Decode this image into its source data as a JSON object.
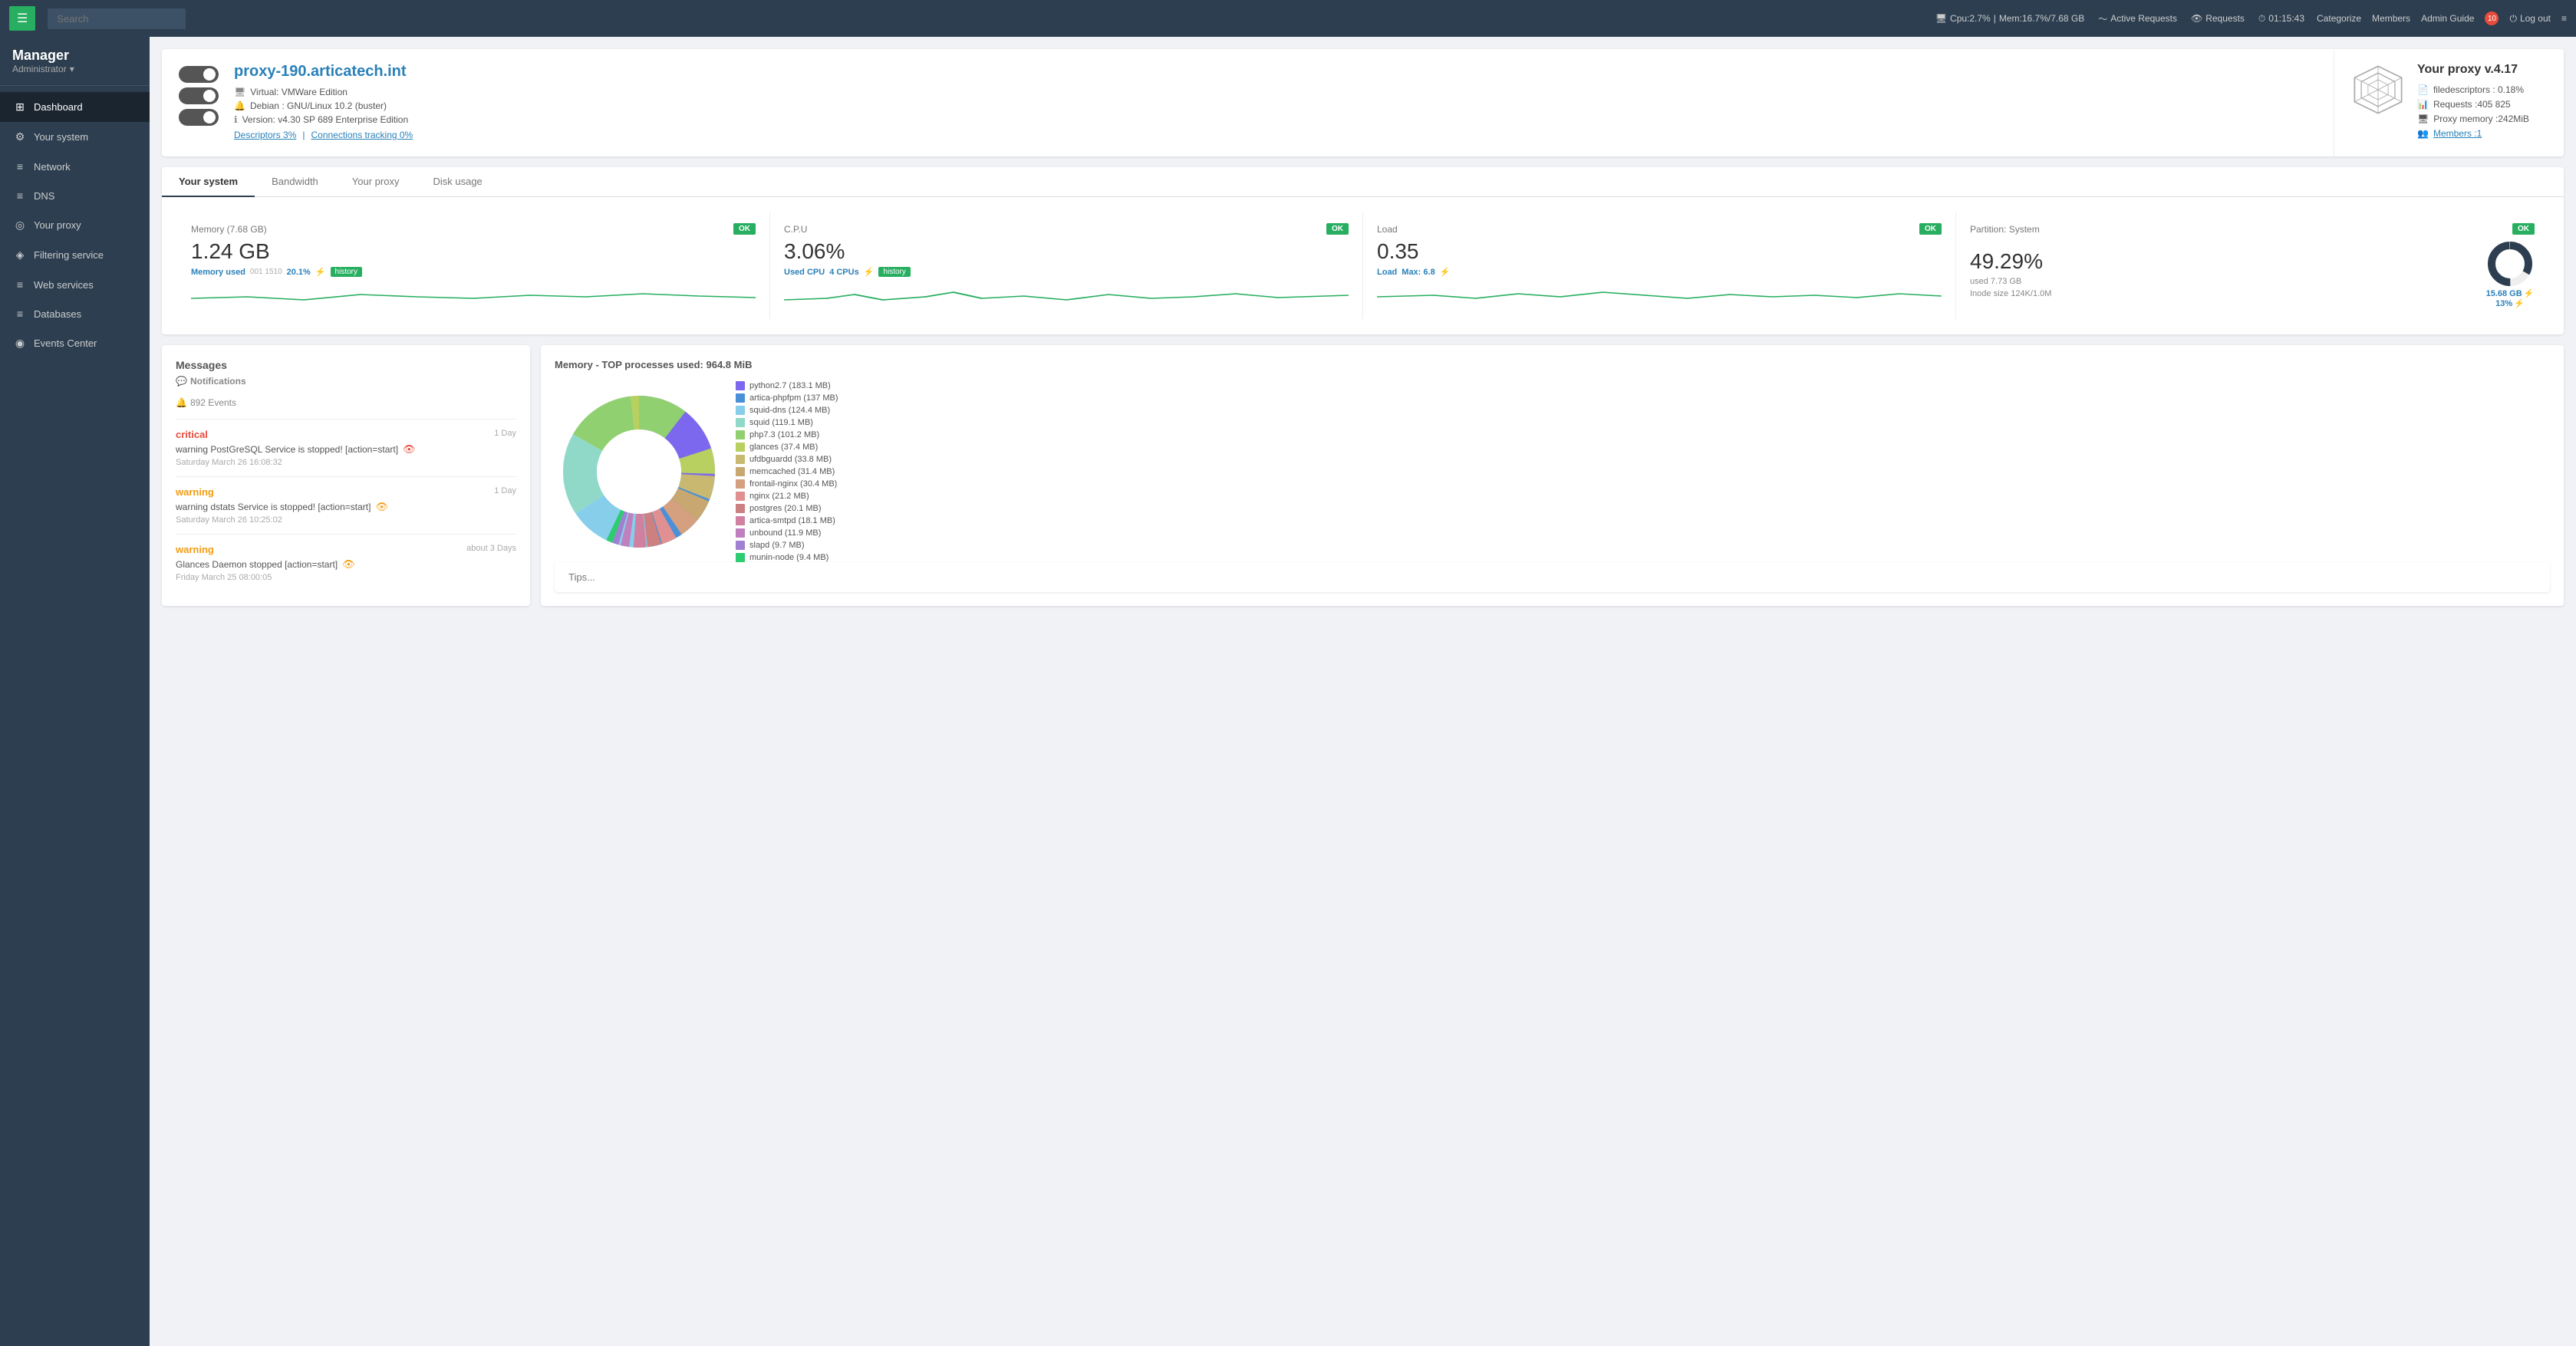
{
  "topbar": {
    "menu_label": "☰",
    "search_placeholder": "Search",
    "cpu": "Cpu:2.7%",
    "mem": "Mem:16.7%/7.68 GB",
    "active_requests_label": "Active Requests",
    "requests_label": "Requests",
    "time": "01:15:43",
    "categorize_label": "Categorize",
    "members_label": "Members",
    "admin_guide_label": "Admin Guide",
    "notification_count": "10",
    "logout_label": "Log out",
    "more_label": "≡"
  },
  "sidebar": {
    "brand_name": "Manager",
    "brand_role": "Administrator",
    "nav_items": [
      {
        "id": "dashboard",
        "label": "Dashboard",
        "icon": "⊞"
      },
      {
        "id": "your-system",
        "label": "Your system",
        "icon": "⚙"
      },
      {
        "id": "network",
        "label": "Network",
        "icon": "≡"
      },
      {
        "id": "dns",
        "label": "DNS",
        "icon": "≡"
      },
      {
        "id": "your-proxy",
        "label": "Your proxy",
        "icon": "◎"
      },
      {
        "id": "filtering-service",
        "label": "Filtering service",
        "icon": "◈"
      },
      {
        "id": "web-services",
        "label": "Web services",
        "icon": "≡"
      },
      {
        "id": "databases",
        "label": "Databases",
        "icon": "≡"
      },
      {
        "id": "events-center",
        "label": "Events Center",
        "icon": "◉"
      }
    ]
  },
  "proxy_header": {
    "hostname": "proxy-190.articatech.int",
    "virtual": "Virtual: VMWare Edition",
    "os": "Debian : GNU/Linux 10.2 (buster)",
    "version": "Version: v4.30 SP 689 Enterprise Edition",
    "descriptors_link": "Descriptors 3%",
    "connections_link": "Connections tracking 0%",
    "proxy_version": "Your proxy v.4.17",
    "filedescriptors": "filedescriptors : 0.18%",
    "requests_stat": "Requests :405 825",
    "proxy_memory": "Proxy memory :242MiB",
    "members_stat": "Members :1"
  },
  "tabs": {
    "items": [
      {
        "id": "your-system",
        "label": "Your system"
      },
      {
        "id": "bandwidth",
        "label": "Bandwidth"
      },
      {
        "id": "your-proxy",
        "label": "Your proxy"
      },
      {
        "id": "disk-usage",
        "label": "Disk usage"
      }
    ],
    "active": "your-system"
  },
  "stats": {
    "memory": {
      "title": "Memory (7.68 GB)",
      "status": "OK",
      "value": "1.24 GB",
      "sub1_label": "Memory used",
      "sub1_note": "001 1510",
      "sub1_pct": "20.1%",
      "history_label": "history"
    },
    "cpu": {
      "title": "C.P.U",
      "status": "OK",
      "value": "3.06%",
      "sub1_label": "Used CPU",
      "sub2_label": "4 CPUs",
      "history_label": "history"
    },
    "load": {
      "title": "Load",
      "status": "OK",
      "value": "0.35",
      "sub1_label": "Load",
      "sub2_label": "Max: 6.8"
    },
    "partition": {
      "title": "Partition: System",
      "status": "OK",
      "value": "49.29%",
      "used": "used 7.73 GB",
      "inode": "Inode size 124K/1.0M",
      "size": "15.68 GB",
      "size_pct": "13%"
    }
  },
  "messages": {
    "title": "Messages",
    "notifications_title": "Notifications",
    "notifications_icon": "💬",
    "events_count": "892 Events",
    "events_icon": "🔔",
    "items": [
      {
        "type": "critical",
        "type_label": "critical",
        "time_label": "1 Day",
        "text": "warning PostGreSQL Service is stopped! [action=start]",
        "has_eye": true,
        "eye_type": "critical",
        "date": "Saturday March 26 16:08:32"
      },
      {
        "type": "warning",
        "type_label": "warning",
        "time_label": "1 Day",
        "text": "warning dstats Service is stopped! [action=start]",
        "has_eye": true,
        "eye_type": "warning",
        "date": "Saturday March 26 10:25:02"
      },
      {
        "type": "warning",
        "type_label": "warning",
        "time_label": "about 3 Days",
        "text": "Glances Daemon stopped [action=start]",
        "has_eye": true,
        "eye_type": "warning",
        "date": "Friday March 25 08:00:05"
      }
    ]
  },
  "memory_chart": {
    "title": "Memory - TOP processes used: 964.8 MiB",
    "legend": [
      {
        "label": "python2.7 (183.1 MB)",
        "color": "#7b68ee"
      },
      {
        "label": "artica-phpfpm (137 MB)",
        "color": "#4a90d9"
      },
      {
        "label": "squid-dns (124.4 MB)",
        "color": "#87ceeb"
      },
      {
        "label": "squid (119.1 MB)",
        "color": "#90d9c8"
      },
      {
        "label": "php7.3 (101.2 MB)",
        "color": "#90d070"
      },
      {
        "label": "glances (37.4 MB)",
        "color": "#b8d060"
      },
      {
        "label": "ufdbguardd (33.8 MB)",
        "color": "#c8b870"
      },
      {
        "label": "memcached (31.4 MB)",
        "color": "#c8a870"
      },
      {
        "label": "frontail-nginx (30.4 MB)",
        "color": "#d4a080"
      },
      {
        "label": "nginx (21.2 MB)",
        "color": "#e09090"
      },
      {
        "label": "postgres (20.1 MB)",
        "color": "#cc8080"
      },
      {
        "label": "artica-smtpd (18.1 MB)",
        "color": "#d080a0"
      },
      {
        "label": "unbound (11.9 MB)",
        "color": "#c080c0"
      },
      {
        "label": "slapd (9.7 MB)",
        "color": "#a080d0"
      },
      {
        "label": "munin-node (9.4 MB)",
        "color": "#2ecc71"
      }
    ]
  },
  "tips": {
    "label": "Tips..."
  }
}
